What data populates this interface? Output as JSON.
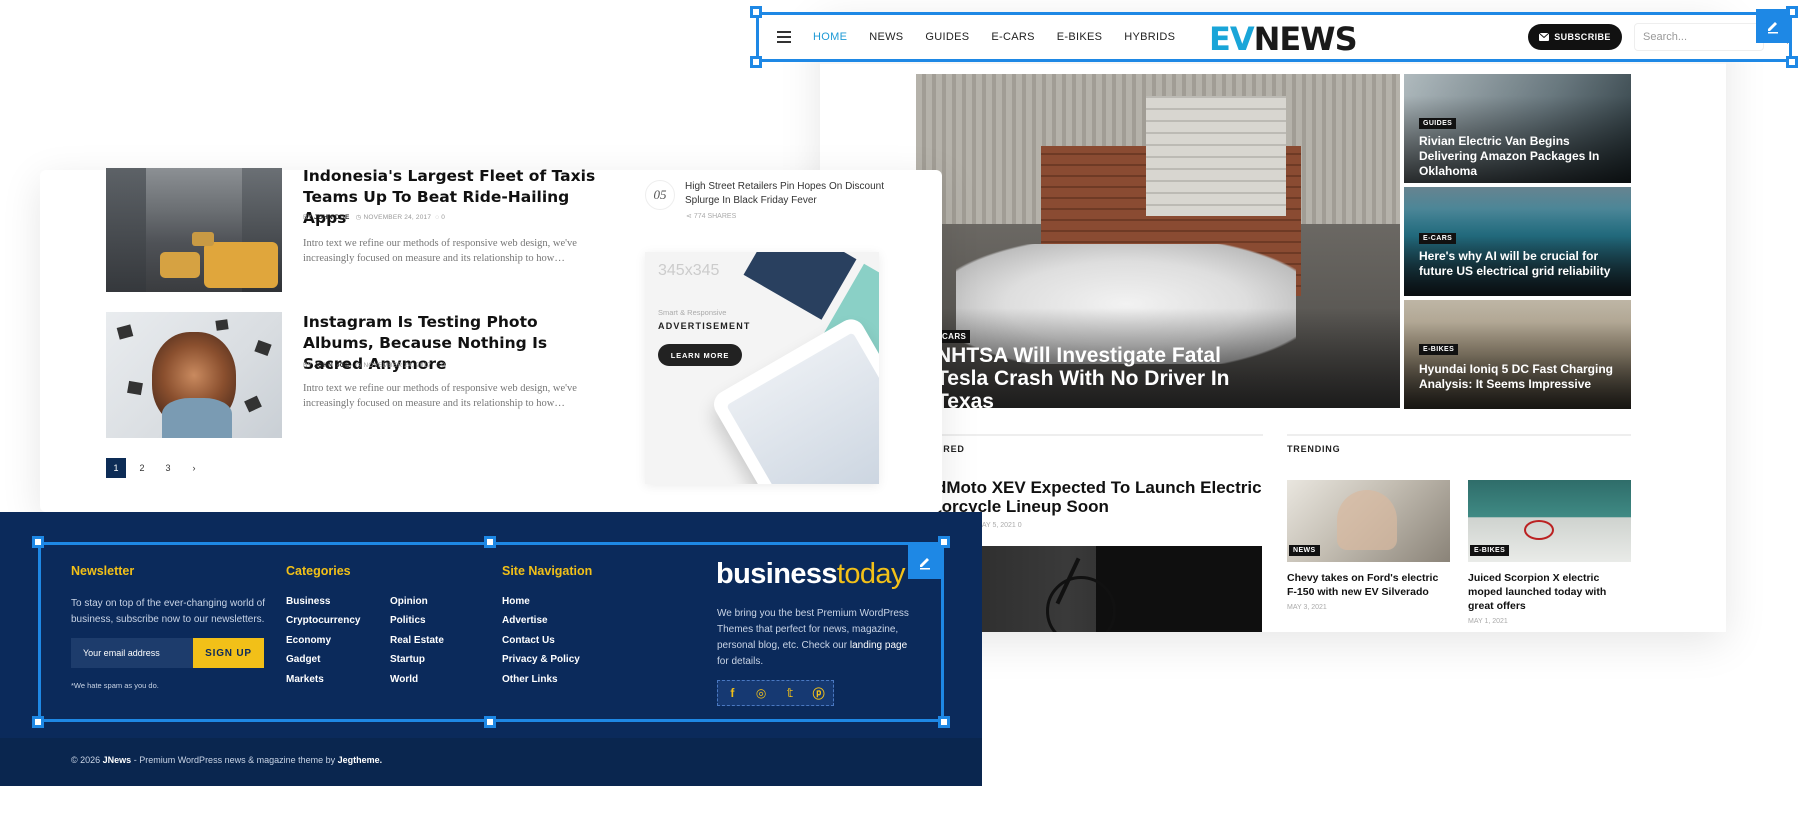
{
  "evnews": {
    "nav": [
      "HOME",
      "NEWS",
      "GUIDES",
      "E-CARS",
      "E-BIKES",
      "HYBRIDS"
    ],
    "logo_ev": "EV",
    "logo_news": "NEWS",
    "subscribe_label": "SUBSCRIBE",
    "search_placeholder": "Search...",
    "hero": {
      "category": "CARS",
      "title": "NHTSA Will Investigate Fatal Tesla Crash With No Driver In Texas"
    },
    "side_posts": [
      {
        "category": "GUIDES",
        "title": "Rivian Electric Van Begins Delivering Amazon Packages In Oklahoma"
      },
      {
        "category": "E-CARS",
        "title": "Here's why AI will be crucial for future US electrical grid reliability"
      },
      {
        "category": "E-BIKES",
        "title": "Hyundai Ioniq 5 DC Fast Charging Analysis: It Seems Impressive"
      }
    ],
    "featured_label": "URED",
    "featured_title": "dMoto XEV Expected To Launch Electric torcycle Lineup Soon",
    "featured_meta": "MAY 5, 2021   0",
    "trending_label": "TRENDING",
    "trending": [
      {
        "category": "NEWS",
        "title": "Chevy takes on Ford's electric F-150 with new EV Silverado",
        "date": "MAY 3, 2021"
      },
      {
        "category": "E-BIKES",
        "title": "Juiced Scorpion X electric moped launched today with great offers",
        "date": "MAY 1, 2021"
      }
    ]
  },
  "blog": {
    "posts": [
      {
        "title": "Indonesia's Largest Fleet of Taxis Teams Up To Beat Ride-Hailing Apps",
        "by": "BY",
        "author": "JOHN DOE",
        "date": "NOVEMBER 24, 2017",
        "comments": "0",
        "intro": "Intro text we refine our methods of responsive web design, we've increasingly focused on measure and its relationship to how…"
      },
      {
        "title": "Instagram Is Testing Photo Albums, Because Nothing Is Sacred Anymore",
        "by": "BY",
        "author": "JOHN DOE",
        "date": "NOVEMBER 24, 2017",
        "comments": "0",
        "intro": "Intro text we refine our methods of responsive web design, we've increasingly focused on measure and its relationship to how…"
      }
    ],
    "pages": [
      "1",
      "2",
      "3",
      "›"
    ],
    "rank": {
      "number": "05",
      "title": "High Street Retailers Pin Hopes On Discount Splurge In Black Friday Fever",
      "shares": "774 SHARES"
    },
    "ad": {
      "size": "345x345",
      "subtitle": "Smart & Responsive",
      "title": "ADVERTISEMENT",
      "button": "LEARN MORE"
    }
  },
  "footer": {
    "newsletter_heading": "Newsletter",
    "newsletter_text": "To stay on top of the ever-changing world of business, subscribe now to our newsletters.",
    "email_placeholder": "Your email address",
    "signup_label": "SIGN UP",
    "spam_note": "*We hate spam as you do.",
    "categories_heading": "Categories",
    "categories_col1": [
      "Business",
      "Cryptocurrency",
      "Economy",
      "Gadget",
      "Markets"
    ],
    "categories_col2": [
      "Opinion",
      "Politics",
      "Real Estate",
      "Startup",
      "World"
    ],
    "site_nav_heading": "Site Navigation",
    "site_nav": [
      "Home",
      "Advertise",
      "Contact Us",
      "Privacy & Policy",
      "Other Links"
    ],
    "logo_business": "business",
    "logo_today": "today",
    "about_pre": "We bring you the best Premium WordPress Themes that perfect for news, magazine, personal blog, etc. Check our",
    "about_link": "landing page",
    "about_post": "for details.",
    "socials": [
      "facebook-icon",
      "instagram-icon",
      "twitter-icon",
      "pinterest-icon"
    ],
    "copy_pre": "© 2026",
    "copy_brand": "JNews",
    "copy_mid": "- Premium WordPress news & magazine theme by",
    "copy_author": "Jegtheme."
  },
  "colors": {
    "accent_blue": "#1e88e5",
    "ev_cyan": "#19a5d8",
    "footer_navy": "#0b2a5b",
    "footer_yellow": "#f2c018",
    "pager_active": "#0d2c56"
  }
}
